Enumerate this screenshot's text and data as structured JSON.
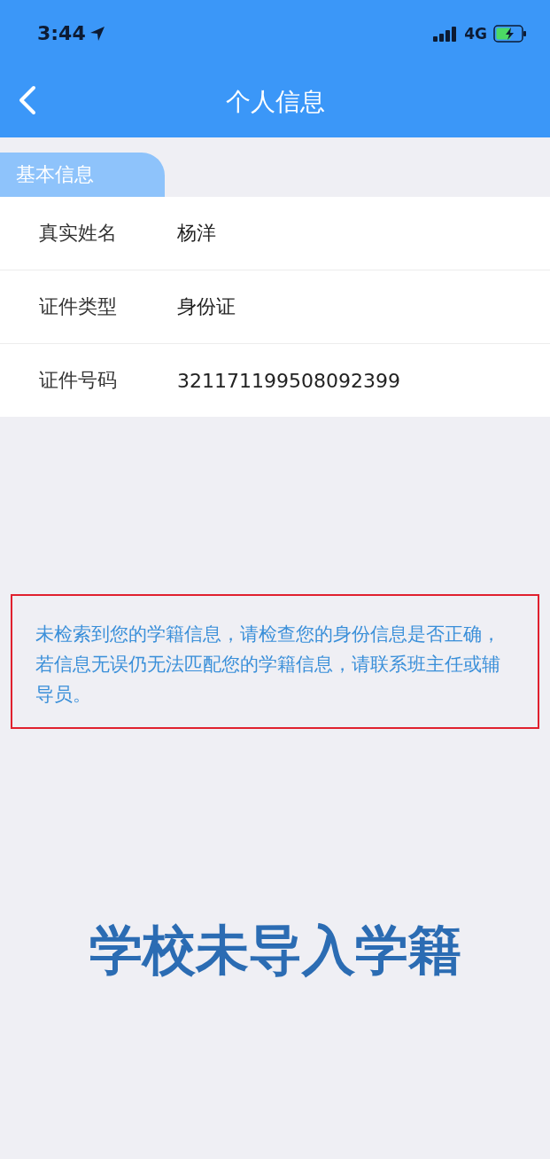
{
  "status_bar": {
    "time": "3:44",
    "network": "4G"
  },
  "nav": {
    "title": "个人信息"
  },
  "section": {
    "title": "基本信息"
  },
  "fields": [
    {
      "label": "真实姓名",
      "value": "杨洋"
    },
    {
      "label": "证件类型",
      "value": "身份证"
    },
    {
      "label": "证件号码",
      "value": "321171199508092399"
    }
  ],
  "notice": "未检索到您的学籍信息，请检查您的身份信息是否正确，若信息无误仍无法匹配您的学籍信息，请联系班主任或辅导员。",
  "caption": "学校未导入学籍"
}
